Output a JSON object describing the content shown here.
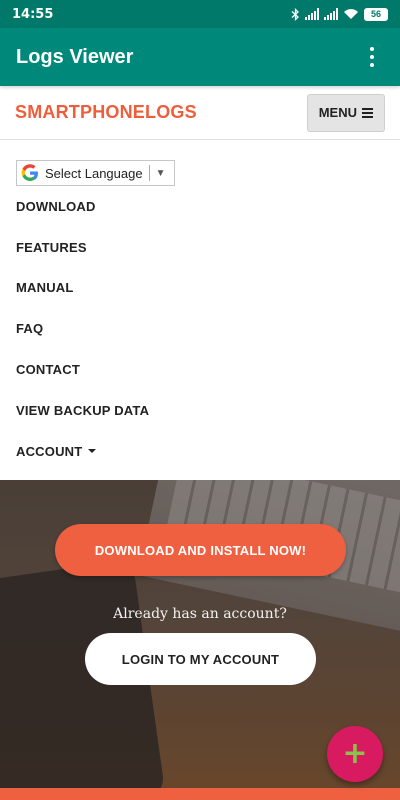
{
  "status_bar": {
    "time": "14:55",
    "battery": "56",
    "icons": [
      "bluetooth-icon",
      "signal-icon",
      "signal-icon",
      "wifi-icon",
      "battery-icon"
    ]
  },
  "app_bar": {
    "title": "Logs Viewer",
    "overflow_icon": "more-vert-icon"
  },
  "site_header": {
    "brand": "SMARTPHONELOGS",
    "menu_label": "MENU"
  },
  "language_select": {
    "label": "Select Language",
    "arrow": "▼"
  },
  "nav": {
    "items": [
      {
        "label": "DOWNLOAD"
      },
      {
        "label": "FEATURES"
      },
      {
        "label": "MANUAL"
      },
      {
        "label": "FAQ"
      },
      {
        "label": "CONTACT"
      },
      {
        "label": "VIEW BACKUP DATA"
      },
      {
        "label": "ACCOUNT"
      }
    ]
  },
  "hero": {
    "download_cta": "DOWNLOAD AND INSTALL NOW!",
    "account_prompt": "Already has an account?",
    "login_cta": "LOGIN TO MY ACCOUNT"
  },
  "fab": {
    "symbol": "+"
  },
  "colors": {
    "status_bar": "#00796b",
    "app_bar": "#00897b",
    "brand": "#ef5d3a",
    "cta": "#ef6040",
    "fab": "#d81b60",
    "fab_icon": "#8bc34a"
  }
}
